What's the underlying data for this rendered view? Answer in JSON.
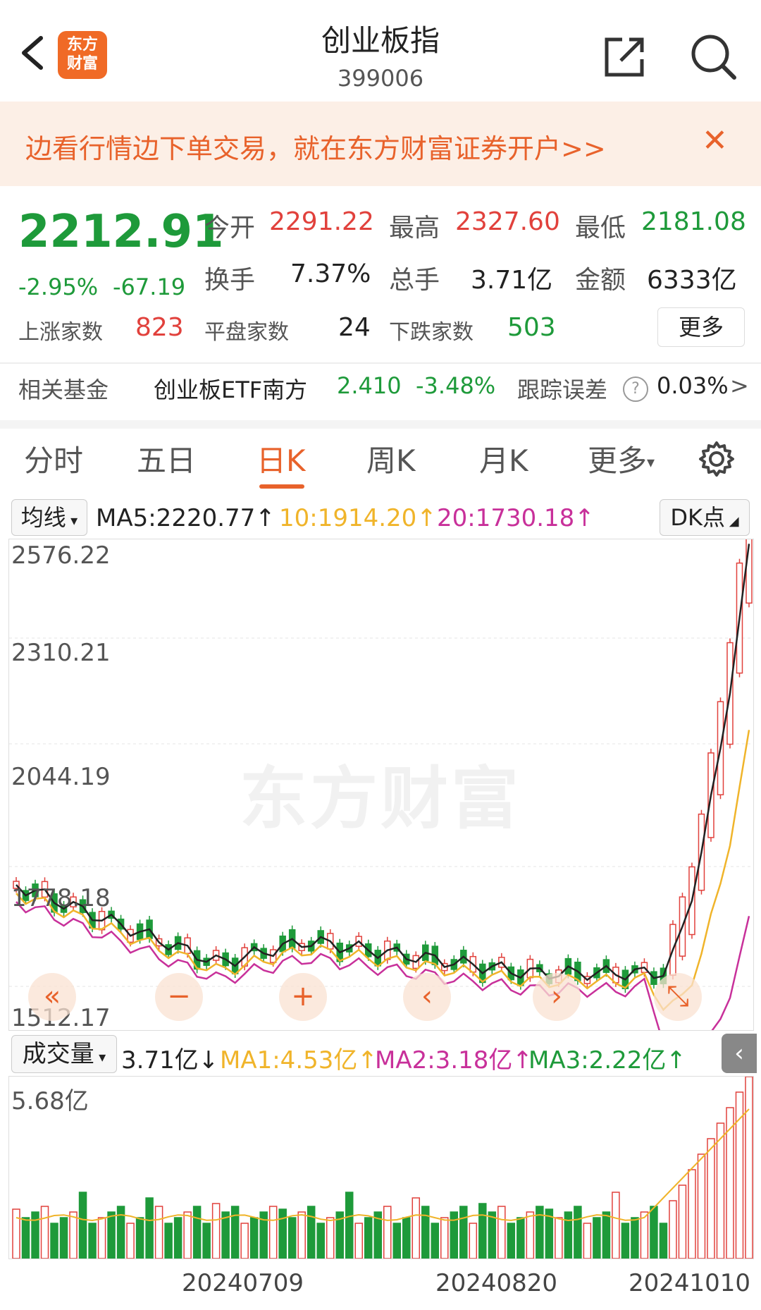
{
  "header": {
    "back_icon": "chevron-left-icon",
    "logo_line1": "东方",
    "logo_line2": "财富",
    "title": "创业板指",
    "code": "399006",
    "share_icon": "share-icon",
    "search_icon": "search-icon"
  },
  "banner": {
    "text": "边看行情边下单交易，就在东方财富证券开户>>",
    "close": "✕"
  },
  "quote": {
    "price": "2212.91",
    "change_pct": "-2.95%",
    "change_abs": "-67.19",
    "open_label": "今开",
    "open_value": "2291.22",
    "high_label": "最高",
    "high_value": "2327.60",
    "low_label": "最低",
    "low_value": "2181.08",
    "turnover_label": "换手",
    "turnover_value": "7.37%",
    "volume_label": "总手",
    "volume_value": "3.71亿",
    "amount_label": "金额",
    "amount_value": "6333亿",
    "up_label": "上涨家数",
    "up_value": "823",
    "flat_label": "平盘家数",
    "flat_value": "24",
    "down_label": "下跌家数",
    "down_value": "503",
    "more_label": "更多"
  },
  "fund": {
    "label": "相关基金",
    "name": "创业板ETF南方",
    "price": "2.410",
    "change": "-3.48%",
    "error_label": "跟踪误差",
    "error_value": "0.03%",
    "arrow": ">"
  },
  "tabs": [
    "分时",
    "五日",
    "日K",
    "周K",
    "月K",
    "更多"
  ],
  "active_tab": "日K",
  "ma": {
    "selector": "均线",
    "ma5": "MA5:2220.77↑",
    "ma10": "10:1914.20↑",
    "ma20": "20:1730.18↑",
    "dk": "DK点"
  },
  "price_axis": [
    "2576.22",
    "2310.21",
    "2044.19",
    "1778.18",
    "1512.17"
  ],
  "watermark": "东方财富",
  "controls": [
    "«",
    "−",
    "+",
    "‹",
    "›",
    "⤡"
  ],
  "volume": {
    "selector": "成交量",
    "current": "3.71亿↓",
    "ma1": "MA1:4.53亿↑",
    "ma2": "MA2:3.18亿↑",
    "ma3": "MA3:2.22亿↑",
    "axis_max": "5.68亿"
  },
  "dates": [
    "20240709",
    "20240820",
    "20241010"
  ],
  "colors": {
    "up": "#e1413c",
    "down": "#1e9a3a",
    "accent": "#e8622b",
    "ma5": "#222222",
    "ma10": "#f0b42a",
    "ma20": "#c8309a"
  }
}
